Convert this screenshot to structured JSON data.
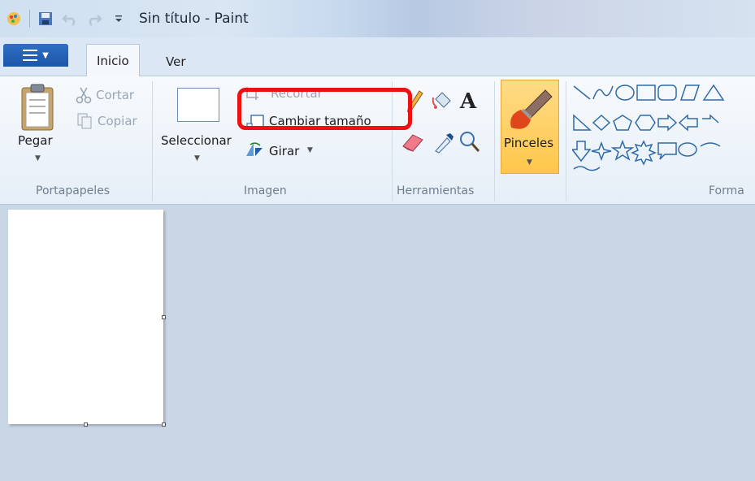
{
  "window": {
    "title": "Sin título - Paint"
  },
  "tabs": {
    "inicio": "Inicio",
    "ver": "Ver"
  },
  "portapapeles": {
    "group_label": "Portapapeles",
    "pegar": "Pegar",
    "cortar": "Cortar",
    "copiar": "Copiar"
  },
  "imagen": {
    "group_label": "Imagen",
    "seleccionar": "Seleccionar",
    "recortar": "Recortar",
    "cambiar_tamano": "Cambiar tamaño",
    "girar": "Girar"
  },
  "herramientas": {
    "group_label": "Herramientas"
  },
  "pinceles": {
    "label": "Pinceles"
  },
  "formas": {
    "group_label": "Forma"
  },
  "colors": {
    "accent_blue": "#1b55a8",
    "highlight_red": "#ee1111",
    "brush_orange": "#ffc74a",
    "workspace_bg": "#c9d6e6"
  }
}
